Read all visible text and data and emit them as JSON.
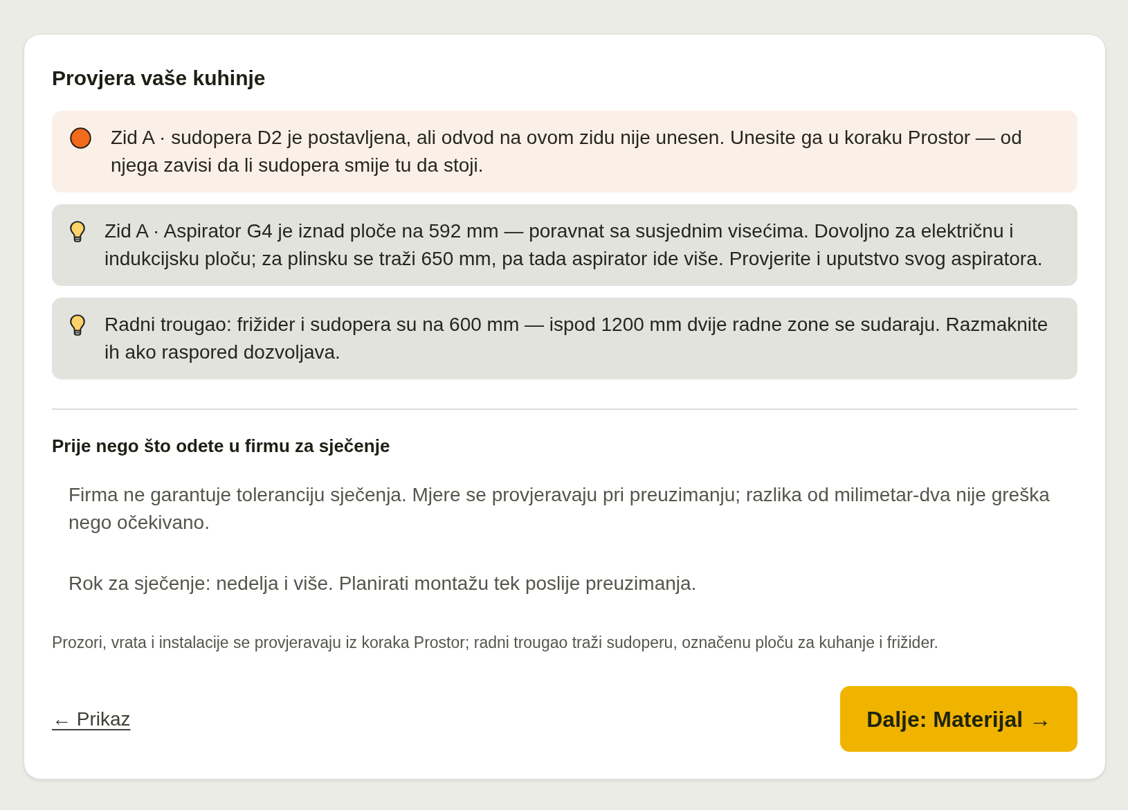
{
  "title": "Provjera vaše kuhinje",
  "notices": [
    {
      "kind": "warning",
      "text": "Zid A · sudopera D2 je postavljena, ali odvod na ovom zidu nije unesen. Unesite ga u koraku Prostor — od njega zavisi da li sudopera smije tu da stoji."
    },
    {
      "kind": "tip",
      "text": "Zid A · Aspirator G4 je iznad ploče na 592 mm — poravnat sa susjednim visećima. Dovoljno za električnu i indukcijsku ploču; za plinsku se traži 650 mm, pa tada aspirator ide više. Provjerite i uputstvo svog aspiratora."
    },
    {
      "kind": "tip",
      "text": "Radni trougao: frižider i sudopera su na 600 mm — ispod 1200 mm dvije radne zone se sudaraju. Razmaknite ih ako raspored dozvoljava."
    }
  ],
  "section": {
    "title": "Prije nego što odete u firmu za sječenje",
    "paragraphs": [
      "Firma ne garantuje toleranciju sječenja. Mjere se provjeravaju pri preuzimanju; razlika od milimetar-dva nije greška nego očekivano.",
      "Rok za sječenje: nedelja i više. Planirati montažu tek poslije preuzimanja."
    ]
  },
  "note": "Prozori, vrata i instalacije se provjeravaju iz koraka Prostor; radni trougao traži sudoperu, označenu ploču za kuhanje i frižider.",
  "back_link": "← Prikaz",
  "next_button": "Dalje: Materijal →"
}
